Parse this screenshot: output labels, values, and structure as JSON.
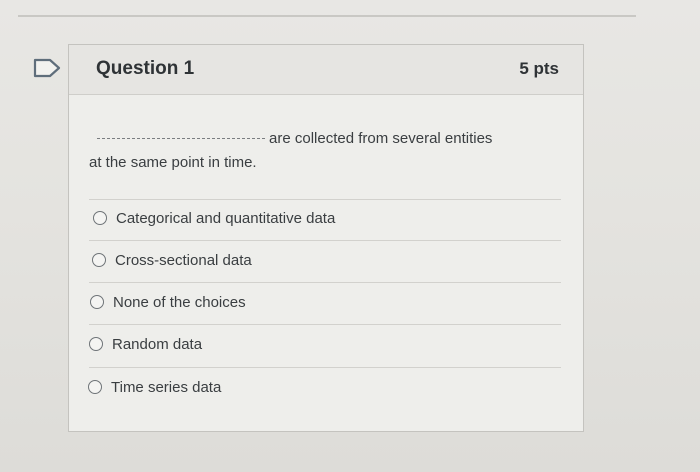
{
  "question": {
    "title": "Question 1",
    "points": "5 pts",
    "text_after_blank": "are collected from several entities",
    "text_line_two": "at the same point in time."
  },
  "answers": [
    "Categorical and quantitative data",
    "Cross-sectional data",
    "None of the choices",
    "Random data",
    "Time series data"
  ],
  "icons": {
    "flag": "flag-icon",
    "radio": "radio-icon"
  },
  "colors": {
    "background": "#e4e3df",
    "card": "#eeeeeb",
    "text": "#2f3336",
    "border": "#c4c3bf"
  }
}
